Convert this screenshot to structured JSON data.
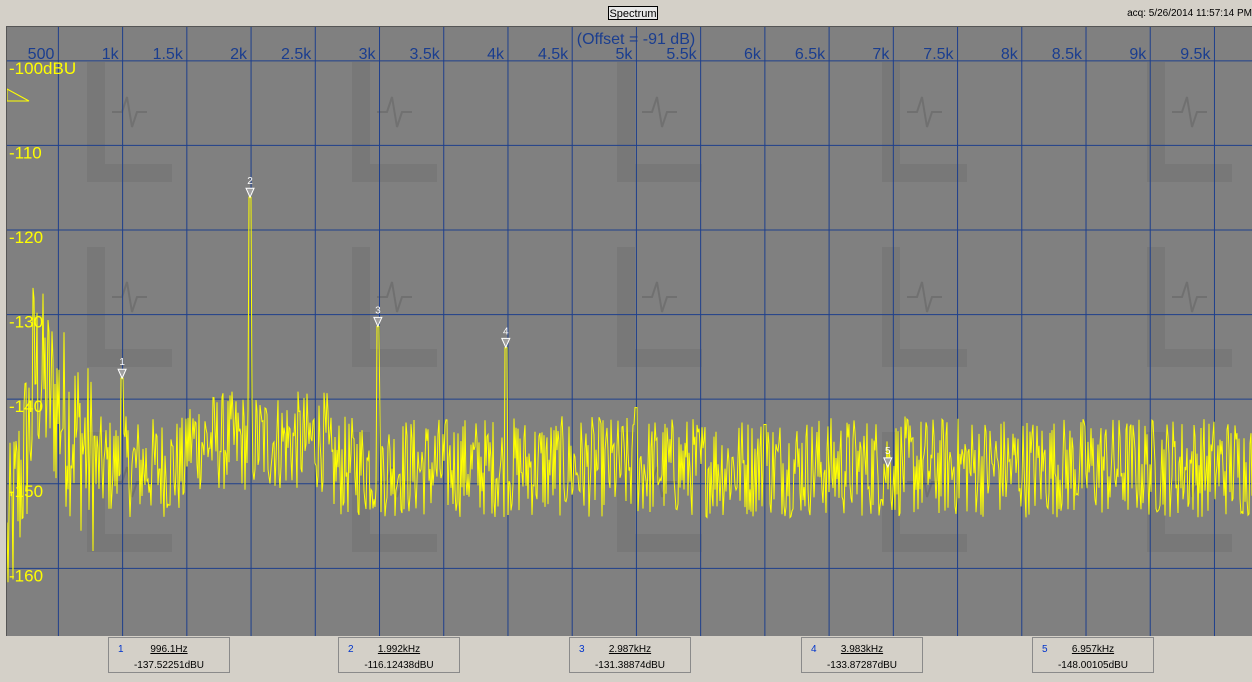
{
  "header": {
    "title": "Spectrum",
    "acq_label": "acq: 5/26/2014 11:57:14 PM"
  },
  "chart_data": {
    "type": "line",
    "offset_label": "(Offset = -91 dB)",
    "x_tick_labels": [
      "500",
      "1k",
      "1.5k",
      "2k",
      "2.5k",
      "3k",
      "3.5k",
      "4k",
      "4.5k",
      "5k",
      "5.5k",
      "6k",
      "6.5k",
      "7k",
      "7.5k",
      "8k",
      "8.5k",
      "9k",
      "9.5k"
    ],
    "x_ticks_hz": [
      500,
      1000,
      1500,
      2000,
      2500,
      3000,
      3500,
      4000,
      4500,
      5000,
      5500,
      6000,
      6500,
      7000,
      7500,
      8000,
      8500,
      9000,
      9500
    ],
    "xlim": [
      100,
      9800
    ],
    "y_tick_labels": [
      "-100dBU",
      "-110",
      "-120",
      "-130",
      "-140",
      "-150",
      "-160"
    ],
    "y_ticks_dbu": [
      -100,
      -110,
      -120,
      -130,
      -140,
      -150,
      -160
    ],
    "ylim": [
      -96,
      -168
    ],
    "grid": true,
    "colors": {
      "background": "#808080",
      "grid": "#1e3f8c",
      "trace": "#ffff00",
      "labels": "#ffff00",
      "axis_labels": "#1a3d8f",
      "marker": "#ffffff"
    },
    "noise_floor_dbu": -148,
    "peaks": [
      {
        "x": 996.1,
        "y": -137.5
      },
      {
        "x": 1992,
        "y": -116.1
      },
      {
        "x": 2987,
        "y": -131.4
      },
      {
        "x": 3983,
        "y": -133.9
      },
      {
        "x": 5000,
        "y": -141
      },
      {
        "x": 6000,
        "y": -143
      }
    ]
  },
  "markers": [
    {
      "num": "1",
      "freq_hz": 996.1,
      "freq_label": "996.1Hz",
      "amp_dbu": -137.52251,
      "amp_label": "-137.52251dBU"
    },
    {
      "num": "2",
      "freq_hz": 1992,
      "freq_label": "1.992kHz",
      "amp_dbu": -116.12438,
      "amp_label": "-116.12438dBU"
    },
    {
      "num": "3",
      "freq_hz": 2987,
      "freq_label": "2.987kHz",
      "amp_dbu": -131.38874,
      "amp_label": "-131.38874dBU"
    },
    {
      "num": "4",
      "freq_hz": 3983,
      "freq_label": "3.983kHz",
      "amp_dbu": -133.87287,
      "amp_label": "-133.87287dBU"
    },
    {
      "num": "5",
      "freq_hz": 6957,
      "freq_label": "6.957kHz",
      "amp_dbu": -148.00105,
      "amp_label": "-148.00105dBU"
    }
  ]
}
